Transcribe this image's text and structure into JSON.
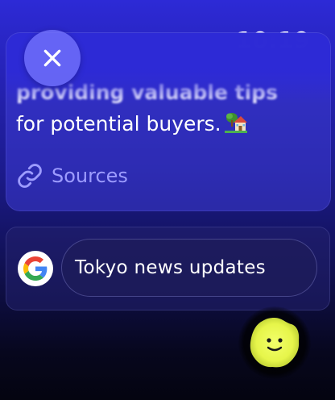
{
  "status": {
    "time": "10:19"
  },
  "close": {
    "icon": "close-icon"
  },
  "answer": {
    "line1": "providing valuable tips",
    "line2": "for potential buyers.",
    "emoji": "house-with-garden-emoji",
    "sources_label": "Sources",
    "sources_icon": "link-icon"
  },
  "search": {
    "provider_icon": "google-logo-icon",
    "query": "Tokyo news updates"
  },
  "assistant": {
    "icon": "smiley-blob-icon",
    "color": "#e6f54a"
  },
  "colors": {
    "accent_link": "#9d9cff",
    "close_button": "#7878ff",
    "background_top": "#2d2ad6",
    "background_bottom": "#040410"
  }
}
